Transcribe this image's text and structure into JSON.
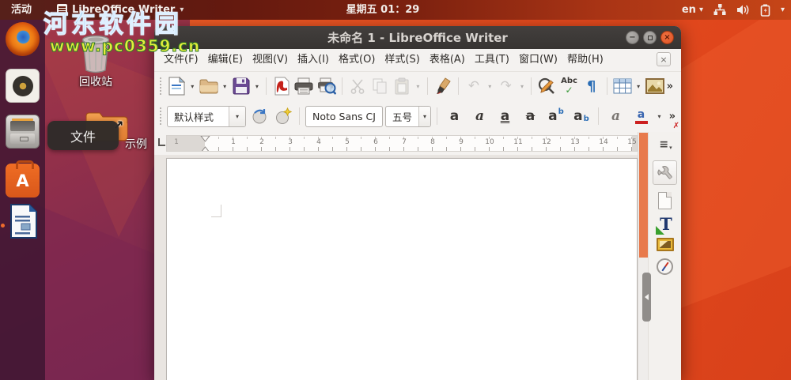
{
  "glyphs": {
    "caret": "▾",
    "chevron_overflow": "»",
    "minus": "−",
    "close_x": "×",
    "undo": "↶",
    "redo": "↷",
    "check": "✓",
    "clear_x": "✗",
    "pilcrow": "¶",
    "shortcut_arrow": "↗",
    "menu_bars": "≡"
  },
  "top_bar": {
    "activities": "活动",
    "app_name": "LibreOffice Writer",
    "clock": "星期五 01：29",
    "keyboard_layout": "en"
  },
  "watermark": {
    "line1": "河东软件园",
    "line2": "www.pc0359.cn"
  },
  "desktop": {
    "trash_label": "回收站",
    "folder_label": "示例",
    "tooltip": "文件"
  },
  "dock": {
    "items": [
      "firefox",
      "rhythmbox",
      "files",
      "ubuntu-software",
      "libreoffice-writer"
    ]
  },
  "window": {
    "title": "未命名 1 - LibreOffice Writer",
    "menus": [
      "文件(F)",
      "编辑(E)",
      "视图(V)",
      "插入(I)",
      "格式(O)",
      "样式(S)",
      "表格(A)",
      "工具(T)",
      "窗口(W)",
      "帮助(H)"
    ],
    "toolbar": {
      "spell_label": "Abc"
    },
    "format_bar": {
      "paragraph_style": "默认样式",
      "font_name": "Noto Sans CJ",
      "font_size": "五号",
      "bold": "a",
      "italic": "a",
      "underline": "a",
      "strikethrough": "a",
      "superscript_main": "a",
      "superscript_small": "b",
      "subscript_main": "a",
      "subscript_small": "b",
      "clear_main": "a",
      "fontcolor_main": "a"
    },
    "ruler": {
      "margin_number": "1",
      "numbers": [
        "1",
        "2",
        "3",
        "4",
        "5",
        "6",
        "7",
        "8",
        "9",
        "10",
        "11",
        "12",
        "13",
        "14",
        "15"
      ]
    },
    "sidebar_tabs": [
      "sidebar-settings",
      "properties",
      "page",
      "styles",
      "gallery",
      "navigator"
    ]
  },
  "colors": {
    "ubuntu_orange": "#e54a1e",
    "aubergine": "#8e2d48",
    "scroll_thumb": "#e87a4c",
    "titlebar": "#3c3937",
    "close_button": "#dd5226",
    "watermark_blue": "#2aa0e8",
    "watermark_yellow": "#e6ec3c"
  }
}
